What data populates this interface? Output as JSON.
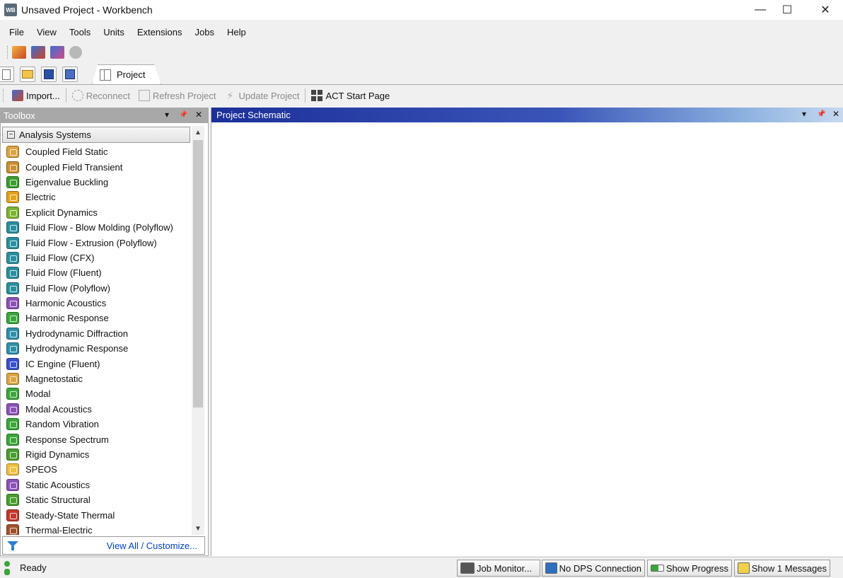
{
  "window": {
    "title": "Unsaved Project - Workbench",
    "app_icon_text": "WB",
    "controls": {
      "minimize": "—",
      "maximize": "☐",
      "close": "✕"
    }
  },
  "menu": [
    "File",
    "View",
    "Tools",
    "Units",
    "Extensions",
    "Jobs",
    "Help"
  ],
  "toolbar1": {
    "icons": [
      "open-project-icon",
      "save-project-icon",
      "save-as-icon",
      "disabled-sphere-icon"
    ]
  },
  "toolbar2": {
    "icons": [
      "new-icon",
      "open-icon",
      "save-icon",
      "save-as-icon"
    ],
    "tab_label": "Project"
  },
  "toolbar3": {
    "import": "Import...",
    "reconnect": "Reconnect",
    "refresh": "Refresh Project",
    "update": "Update Project",
    "act_start": "ACT Start Page"
  },
  "toolbox": {
    "title": "Toolbox",
    "controls": {
      "dropdown": "▾",
      "pin": "📌",
      "close": "✕"
    },
    "section": "Analysis Systems",
    "section_expander": "−",
    "items": [
      {
        "label": "Coupled Field Static",
        "icon": "coupled-field-icon",
        "color": "#d9a441"
      },
      {
        "label": "Coupled Field Transient",
        "icon": "coupled-field-icon",
        "color": "#c98f2e"
      },
      {
        "label": "Eigenvalue Buckling",
        "icon": "buckling-icon",
        "color": "#3a9d2f"
      },
      {
        "label": "Electric",
        "icon": "electric-icon",
        "color": "#e4a11b"
      },
      {
        "label": "Explicit Dynamics",
        "icon": "explicit-icon",
        "color": "#7bb32e"
      },
      {
        "label": "Fluid Flow - Blow Molding (Polyflow)",
        "icon": "fluid-flow-icon",
        "color": "#2a8f9e"
      },
      {
        "label": "Fluid Flow - Extrusion (Polyflow)",
        "icon": "fluid-flow-icon",
        "color": "#2a8f9e"
      },
      {
        "label": "Fluid Flow (CFX)",
        "icon": "fluid-flow-icon",
        "color": "#2a8f9e"
      },
      {
        "label": "Fluid Flow (Fluent)",
        "icon": "fluid-flow-icon",
        "color": "#2a8f9e"
      },
      {
        "label": "Fluid Flow (Polyflow)",
        "icon": "fluid-flow-icon",
        "color": "#2a8f9e"
      },
      {
        "label": "Harmonic Acoustics",
        "icon": "acoustics-icon",
        "color": "#8b52b5"
      },
      {
        "label": "Harmonic Response",
        "icon": "harmonic-icon",
        "color": "#3aa63a"
      },
      {
        "label": "Hydrodynamic Diffraction",
        "icon": "hydrodynamic-icon",
        "color": "#2f8fa8"
      },
      {
        "label": "Hydrodynamic Response",
        "icon": "hydrodynamic-icon",
        "color": "#2f8fa8"
      },
      {
        "label": "IC Engine (Fluent)",
        "icon": "ic-engine-icon",
        "color": "#3a4fd0"
      },
      {
        "label": "Magnetostatic",
        "icon": "magnetostatic-icon",
        "color": "#d9a441"
      },
      {
        "label": "Modal",
        "icon": "modal-icon",
        "color": "#3aa63a"
      },
      {
        "label": "Modal Acoustics",
        "icon": "acoustics-icon",
        "color": "#8b52b5"
      },
      {
        "label": "Random Vibration",
        "icon": "random-vibration-icon",
        "color": "#3aa63a"
      },
      {
        "label": "Response Spectrum",
        "icon": "response-spectrum-icon",
        "color": "#3aa63a"
      },
      {
        "label": "Rigid Dynamics",
        "icon": "rigid-dynamics-icon",
        "color": "#4a9d2f"
      },
      {
        "label": "SPEOS",
        "icon": "speos-icon",
        "color": "#f0c040"
      },
      {
        "label": "Static Acoustics",
        "icon": "acoustics-icon",
        "color": "#8b52b5"
      },
      {
        "label": "Static Structural",
        "icon": "static-structural-icon",
        "color": "#4a9d2f"
      },
      {
        "label": "Steady-State Thermal",
        "icon": "thermal-icon",
        "color": "#c0392b"
      },
      {
        "label": "Thermal-Electric",
        "icon": "thermal-electric-icon",
        "color": "#a0522d"
      }
    ],
    "scroll": {
      "up": "▲",
      "down": "▼"
    },
    "footer_link": "View All / Customize..."
  },
  "schematic": {
    "title": "Project Schematic",
    "controls": {
      "dropdown": "▾",
      "pin": "📌",
      "close": "✕"
    }
  },
  "status": {
    "text": "Ready",
    "buttons": {
      "job_monitor": "Job Monitor...",
      "dps": "No DPS Connection",
      "progress": "Show Progress",
      "messages": "Show 1 Messages"
    }
  }
}
